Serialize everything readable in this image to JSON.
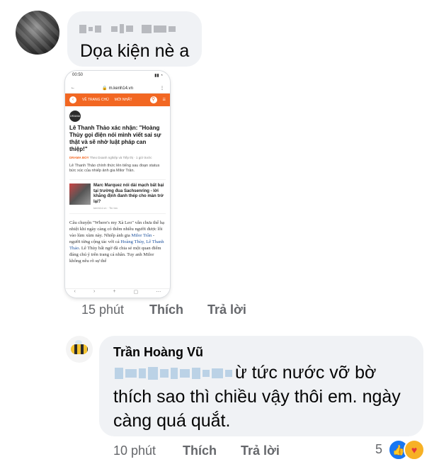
{
  "comment1": {
    "author_redacted": "redacted name",
    "text": "Dọa kiện nè a",
    "time": "15 phút",
    "like_label": "Thích",
    "reply_label": "Trả lời"
  },
  "screenshot": {
    "status_time": "00:50",
    "url": "m.kenh14.vn",
    "nav_home": "VỀ TRANG CHỦ",
    "nav_latest": "MỚI NHẤT",
    "tag": "DRAMA",
    "headline": "Lê Thanh Thảo xác nhận: \"Hoàng Thùy gọi điện nói mình viết sai sự thật và sẽ nhờ luật pháp can thiệp!\"",
    "category": "DRAMA BOY",
    "meta": "Theo Doanh nghiệp và Tiếp thị · 1 giờ trước",
    "sapo": "Lê Thanh Thảo chính thức lên tiếng sau đoạn status bức xúc của nhiếp ảnh gia Milor Trần.",
    "related_title": "Marc Marquez nói dài mạch bất bại tại trường đua Sachsenring - lời khẳng định đanh thép cho màn trở lại?",
    "related_source": "kenh14.vn · Tin tức",
    "story_1": "Câu chuyện \"Where's my Xà Leo\" vẫn chưa thể hạ nhiệt khi ngày càng có thêm nhiều người được lôi vào lùm xùm này. Nhiếp ảnh gia ",
    "story_link1": "Milor Trần",
    "story_2": " - người từng cộng tác với cả ",
    "story_link2": "Hoàng Thùy, Lê Thanh Thảo",
    "story_3": ". Lê Thùy bất ngờ đã chia sẻ một quan điểm đáng chú ý trên trang cá nhân. Tuy anh Milor không nêu rõ sự thể"
  },
  "comment2": {
    "author": "Trần Hoàng Vũ",
    "line1": "ừ tức nước vỡ bờ",
    "line2": "thích sao thì chiều vậy thôi em. ngày",
    "line3": "càng quá quắt.",
    "time": "10 phút",
    "like_label": "Thích",
    "reply_label": "Trả lời",
    "reaction_count": "5"
  },
  "colors": {
    "bubble": "#f0f2f5",
    "meta_text": "#65676b",
    "like_blue": "#1877f2",
    "kenh14_orange": "#f26722"
  }
}
